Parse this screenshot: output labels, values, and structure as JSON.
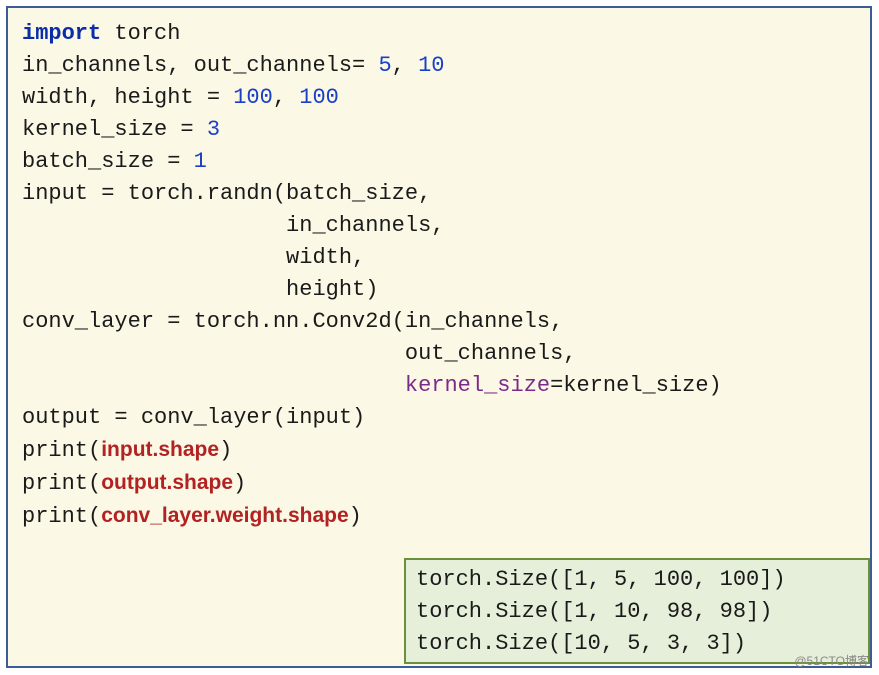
{
  "code": {
    "l1_kw": "import",
    "l1_rest": " torch",
    "l2_a": "in_channels, out_channels= ",
    "l2_n1": "5",
    "l2_sep": ", ",
    "l2_n2": "10",
    "l3_a": "width, height = ",
    "l3_n1": "100",
    "l3_sep": ", ",
    "l3_n2": "100",
    "l4_a": "kernel_size = ",
    "l4_n1": "3",
    "l5_a": "batch_size = ",
    "l5_n1": "1",
    "blank": "",
    "l6": "input = torch.randn(batch_size,",
    "l7": "                    in_channels,",
    "l8": "                    width,",
    "l9": "                    height)",
    "l10": "conv_layer = torch.nn.Conv2d(in_channels,",
    "l11": "                             out_channels,",
    "l12_a": "                             ",
    "l12_kw": "kernel_size",
    "l12_b": "=kernel_size)",
    "l13": "output = conv_layer(input)",
    "p1_a": "print(",
    "p1_b": "input.shape",
    "p1_c": ")",
    "p2_a": "print(",
    "p2_b": "output.shape",
    "p2_c": ")",
    "p3_a": "print(",
    "p3_b": "conv_layer.weight.shape",
    "p3_c": ")"
  },
  "output": {
    "r1": "torch.Size([1, 5, 100, 100])",
    "r2": "torch.Size([1, 10, 98, 98])",
    "r3": "torch.Size([10, 5, 3, 3])"
  },
  "watermark": "@51CTO博客"
}
